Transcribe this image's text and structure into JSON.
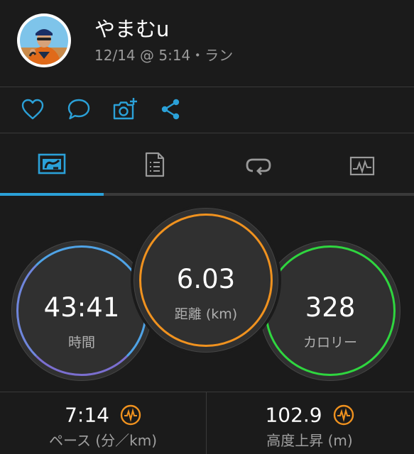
{
  "post": {
    "username": "やまむu",
    "meta": "12/14 @ 5:14・ラン"
  },
  "actions": [
    {
      "name": "like-button",
      "icon": "heart-icon"
    },
    {
      "name": "comment-button",
      "icon": "comment-icon"
    },
    {
      "name": "add-photo-button",
      "icon": "camera-plus-icon"
    },
    {
      "name": "share-button",
      "icon": "share-icon"
    }
  ],
  "tabs": [
    {
      "name": "tab-summary",
      "icon": "stats-icon",
      "active": true
    },
    {
      "name": "tab-details",
      "icon": "document-icon",
      "active": false
    },
    {
      "name": "tab-laps",
      "icon": "loop-icon",
      "active": false
    },
    {
      "name": "tab-charts",
      "icon": "chart-icon",
      "active": false
    }
  ],
  "metrics": {
    "time": {
      "value": "43:41",
      "label": "時間",
      "color": "#4fa3e6"
    },
    "distance": {
      "value": "6.03",
      "label": "距離 (km)",
      "color": "#f0921f"
    },
    "calories": {
      "value": "328",
      "label": "カロリー",
      "color": "#2fd63f"
    }
  },
  "stats": {
    "pace": {
      "value": "7:14",
      "label": "ペース (分／km)"
    },
    "elevation": {
      "value": "102.9",
      "label": "高度上昇 (m)"
    }
  },
  "colors": {
    "accent": "#2ba1d8",
    "background": "#1b1b1b",
    "divider": "#3a3a3a",
    "badge": "#f0921f"
  }
}
